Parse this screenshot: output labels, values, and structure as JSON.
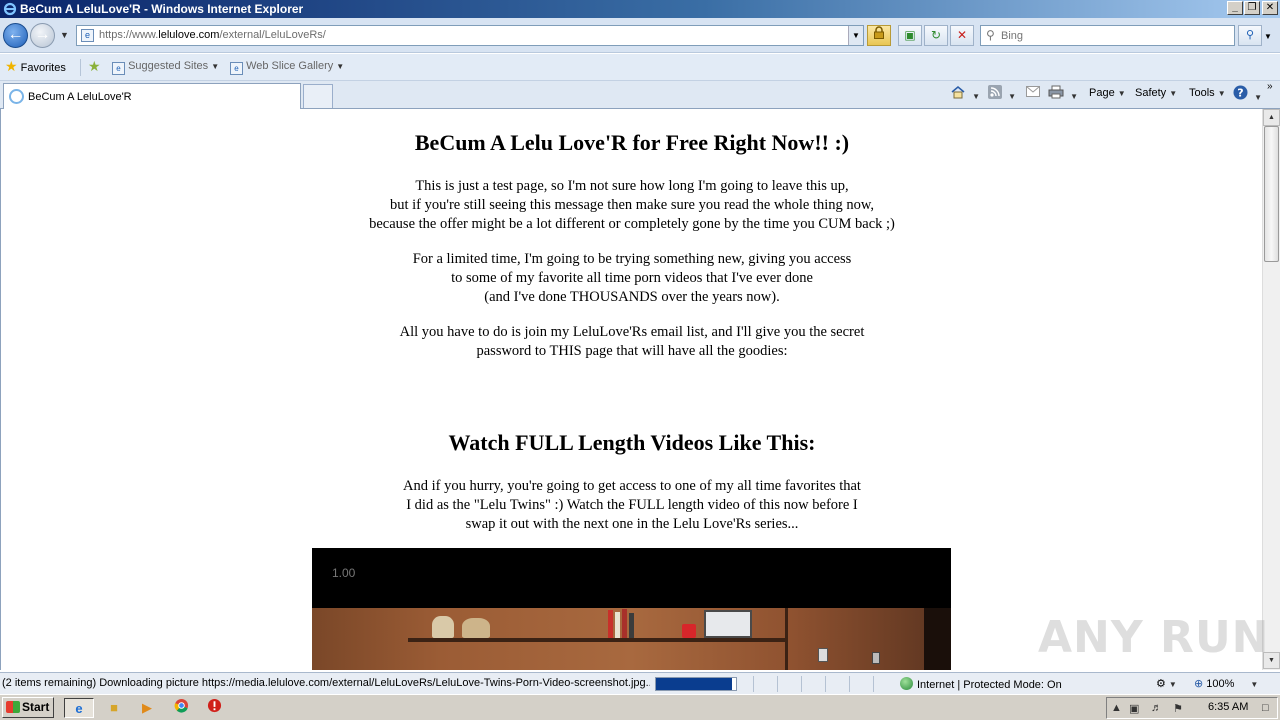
{
  "window": {
    "title": "BeCum A LeluLove'R - Windows Internet Explorer",
    "minimize": "_",
    "restore": "❐",
    "close": "✕"
  },
  "address": {
    "url_prefix": "https://www.",
    "url_domain": "lelulove.com",
    "url_path": "/external/LeluLoveRs/",
    "search_placeholder": "Bing"
  },
  "favorites_bar": {
    "favorites": "Favorites",
    "suggested_sites": "Suggested Sites",
    "web_slice_gallery": "Web Slice Gallery"
  },
  "tabs": {
    "active_label": "BeCum A LeluLove'R"
  },
  "command_bar": {
    "page": "Page",
    "safety": "Safety",
    "tools": "Tools"
  },
  "page": {
    "heading1": "BeCum A Lelu Love'R for Free Right Now!! :)",
    "para1": [
      "This is just a test page, so I'm not sure how long I'm going to leave this up,",
      "but if you're still seeing this message then make sure you read the whole thing now,",
      "because the offer might be a lot different or completely gone by the time you CUM back ;)"
    ],
    "para2": [
      "For a limited time, I'm going to be trying something new, giving you access",
      "to some of my favorite all time porn videos that I've ever done",
      "(and I've done THOUSANDS over the years now)."
    ],
    "para3": [
      "All you have to do is join my LeluLove'Rs email list, and I'll give you the secret",
      "password to THIS page that will have all the goodies:"
    ],
    "heading2": "Watch FULL Length Videos Like This:",
    "para4": [
      "And if you hurry, you're going to get access to one of my all time favorites that",
      "I did as the \"Lelu Twins\" :) Watch the FULL length video of this now before I",
      "swap it out with the next one in the Lelu Love'Rs series..."
    ],
    "video_time": "1.00"
  },
  "watermark": "ANY RUN",
  "status": {
    "message": "(2 items remaining) Downloading picture https://media.lelulove.com/external/LeluLoveRs/LeluLove-Twins-Porn-Video-screenshot.jpg...",
    "progress": 0.95,
    "zone": "Internet | Protected Mode: On",
    "zoom": "100%"
  },
  "taskbar": {
    "start": "Start",
    "time": "6:35 AM"
  },
  "colors": {
    "title_bar": "#0a246a",
    "progress_fill": "#0a3d8f"
  }
}
